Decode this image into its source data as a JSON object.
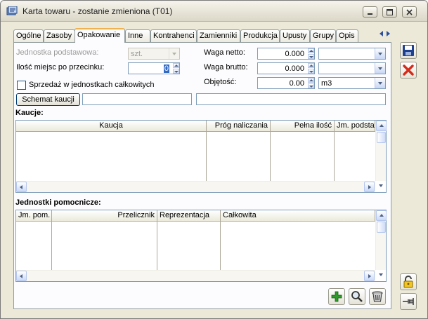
{
  "window": {
    "title": "Karta towaru - zostanie zmieniona (T01)"
  },
  "tabs": [
    {
      "label": "Ogólne"
    },
    {
      "label": "Zasoby"
    },
    {
      "label": "Opakowanie",
      "active": true
    },
    {
      "label": "Inne"
    },
    {
      "label": "Kontrahenci"
    },
    {
      "label": "Zamienniki"
    },
    {
      "label": "Produkcja"
    },
    {
      "label": "Upusty"
    },
    {
      "label": "Grupy"
    },
    {
      "label": "Opis"
    }
  ],
  "form": {
    "jednostka_label": "Jednostka podstawowa:",
    "jednostka_value": "szt.",
    "miejsca_label": "Ilość miejsc po przecinku:",
    "miejsca_value": "0",
    "sprzedaz_label": "Sprzedaż w jednostkach całkowitych",
    "sprzedaz_checked": false,
    "schemat_button": "Schemat kaucji",
    "schemat_value": "",
    "schemat_desc": "",
    "waga_netto_label": "Waga netto:",
    "waga_netto_value": "0.000",
    "waga_netto_unit": "",
    "waga_brutto_label": "Waga brutto:",
    "waga_brutto_value": "0.000",
    "waga_brutto_unit": "",
    "objetosc_label": "Objętość:",
    "objetosc_value": "0.00",
    "objetosc_unit": "m3"
  },
  "kaucje": {
    "title": "Kaucje:",
    "columns": [
      "Kaucja",
      "Próg naliczania",
      "Pełna ilość",
      "Jm. podstaw"
    ],
    "rows": []
  },
  "jednostki": {
    "title": "Jednostki pomocnicze:",
    "columns": [
      "Jm. pom.",
      "Przelicznik",
      "Reprezentacja",
      "Całkowita"
    ],
    "rows": []
  },
  "icons": {
    "save": "save-icon",
    "cancel": "cancel-icon",
    "add": "add-icon",
    "search": "search-icon",
    "delete": "trash-icon",
    "lock": "lock-icon",
    "pin": "pin-icon"
  },
  "colors": {
    "accent_tab": "#f1b14e",
    "cancel_red": "#d42a1a",
    "add_green": "#2f9b2a",
    "save_blue": "#1f3f8f"
  }
}
